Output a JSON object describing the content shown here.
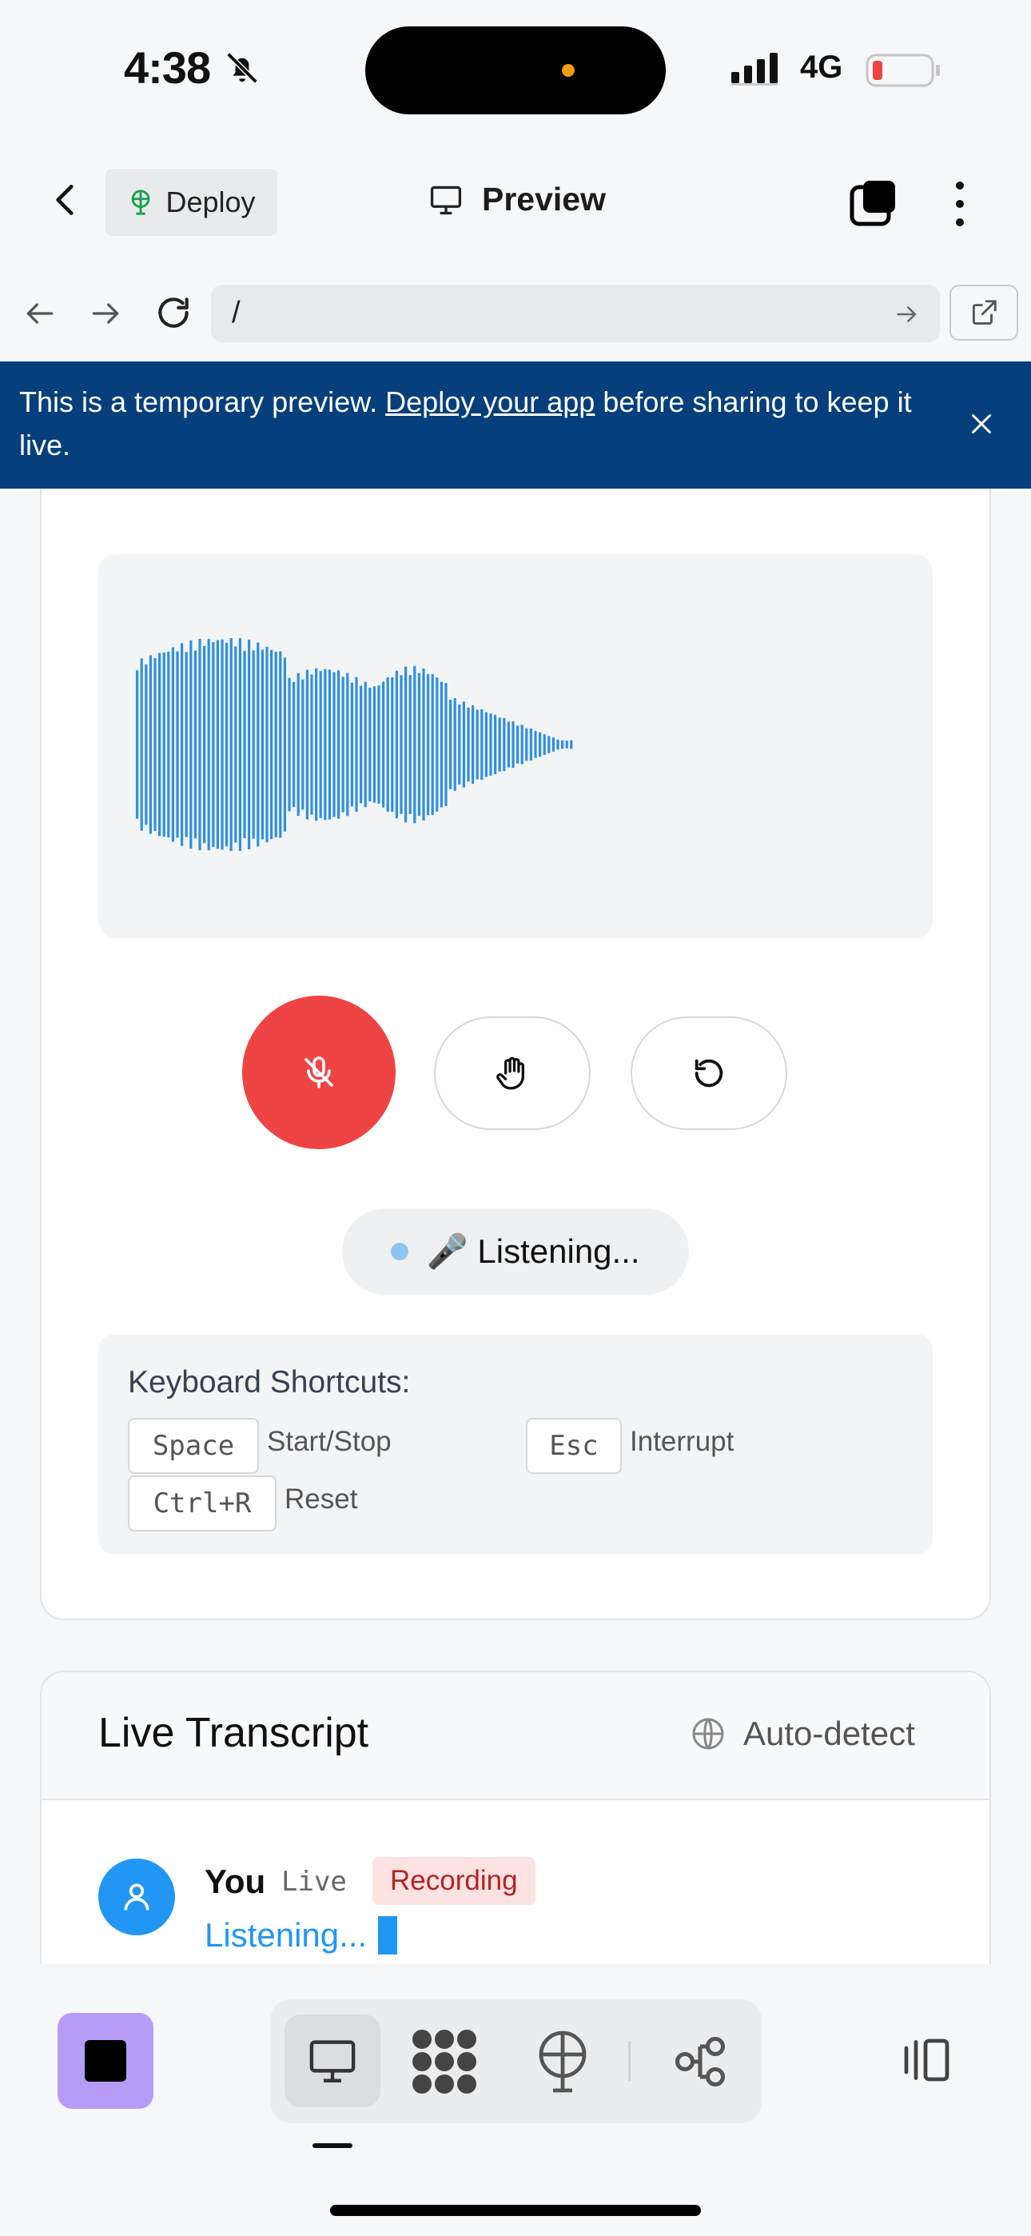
{
  "status_bar": {
    "time": "4:38",
    "network": "4G",
    "icons": [
      "bell-slash-icon",
      "signal-icon",
      "battery-low-icon"
    ],
    "battery_color": "#ef4444"
  },
  "header": {
    "deploy_label": "Deploy",
    "title": "Preview"
  },
  "url_bar": {
    "value": "/"
  },
  "banner": {
    "text_before": "This is a temporary preview. ",
    "link_text": "Deploy your app",
    "text_after": " before sharing to keep it live.",
    "background": "#063f7c"
  },
  "voice": {
    "waveform_color": "#2f8fe0",
    "mic_button_color": "#ef4444",
    "status_text": "🎤 Listening..."
  },
  "shortcuts": {
    "title": "Keyboard Shortcuts:",
    "items": [
      {
        "key": "Space",
        "label": "Start/Stop"
      },
      {
        "key": "Esc",
        "label": "Interrupt"
      },
      {
        "key": "Ctrl+R",
        "label": "Reset"
      }
    ]
  },
  "transcript": {
    "title": "Live Transcript",
    "language": "Auto-detect",
    "entry": {
      "speaker": "You",
      "tag": "Live",
      "badge": "Recording",
      "text": "Listening..."
    }
  },
  "toolbar": {
    "items": [
      "preview-icon",
      "apps-icon",
      "deploy-icon",
      "workflow-icon"
    ],
    "accent": "#b79cf7"
  }
}
